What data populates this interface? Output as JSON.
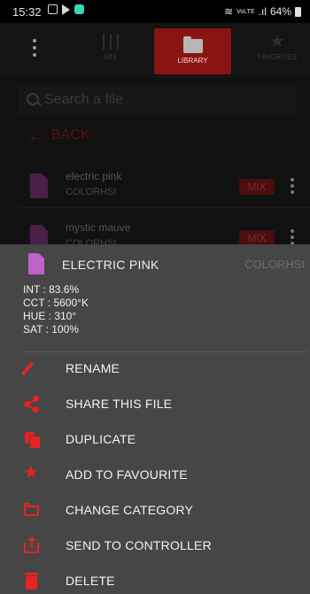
{
  "status_bar": {
    "time": "15:32",
    "signal_text": "VoLTE",
    "battery": "64%"
  },
  "nav": {
    "tabs": [
      {
        "label": "MIX"
      },
      {
        "label": "LIBRARY"
      },
      {
        "label": "FAVORITES"
      }
    ],
    "active_tab": "LIBRARY",
    "active_color": "#8a1414"
  },
  "search": {
    "placeholder": "Search a file"
  },
  "back": {
    "label": "BACK"
  },
  "files": [
    {
      "name": "electric pink",
      "category": "COLORHSI",
      "badge": "MIX"
    },
    {
      "name": "mystic mauve",
      "category": "COLORHSI",
      "badge": "MIX"
    }
  ],
  "sheet": {
    "file_name": "ELECTRIC PINK",
    "category": "COLORHSI",
    "properties": [
      "INT : 83.6%",
      "CCT : 5600°K",
      "HUE : 310°",
      "SAT : 100%"
    ],
    "actions": [
      {
        "label": "RENAME",
        "icon": "pencil-icon"
      },
      {
        "label": "SHARE THIS FILE",
        "icon": "share-icon"
      },
      {
        "label": "DUPLICATE",
        "icon": "duplicate-icon"
      },
      {
        "label": "ADD TO FAVOURITE",
        "icon": "star-icon"
      },
      {
        "label": "CHANGE CATEGORY",
        "icon": "folder-icon"
      },
      {
        "label": "SEND TO CONTROLLER",
        "icon": "upload-icon"
      },
      {
        "label": "DELETE",
        "icon": "trash-icon"
      }
    ],
    "accent": "#e62222",
    "file_color": "#c060c8"
  }
}
